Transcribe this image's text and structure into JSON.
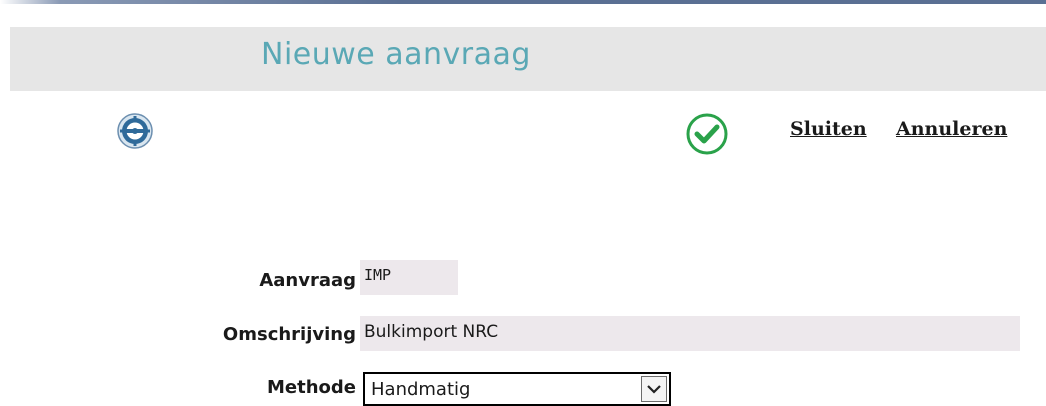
{
  "header": {
    "title": "Nieuwe aanvraag"
  },
  "toolbar": {
    "close_label": "Sluiten",
    "cancel_label": "Annuleren"
  },
  "form": {
    "request": {
      "label": "Aanvraag",
      "value": "IMP"
    },
    "description": {
      "label": "Omschrijving",
      "value": "Bulkimport NRC"
    },
    "method": {
      "label": "Methode",
      "selected": "Handmatig"
    }
  },
  "icons": {
    "settings": "gear-icon",
    "confirm": "check-icon",
    "dropdown": "chevron-down-icon"
  },
  "colors": {
    "title": "#5aa8b5",
    "field_background": "#ede8ec",
    "confirm_green": "#2aa24a"
  }
}
